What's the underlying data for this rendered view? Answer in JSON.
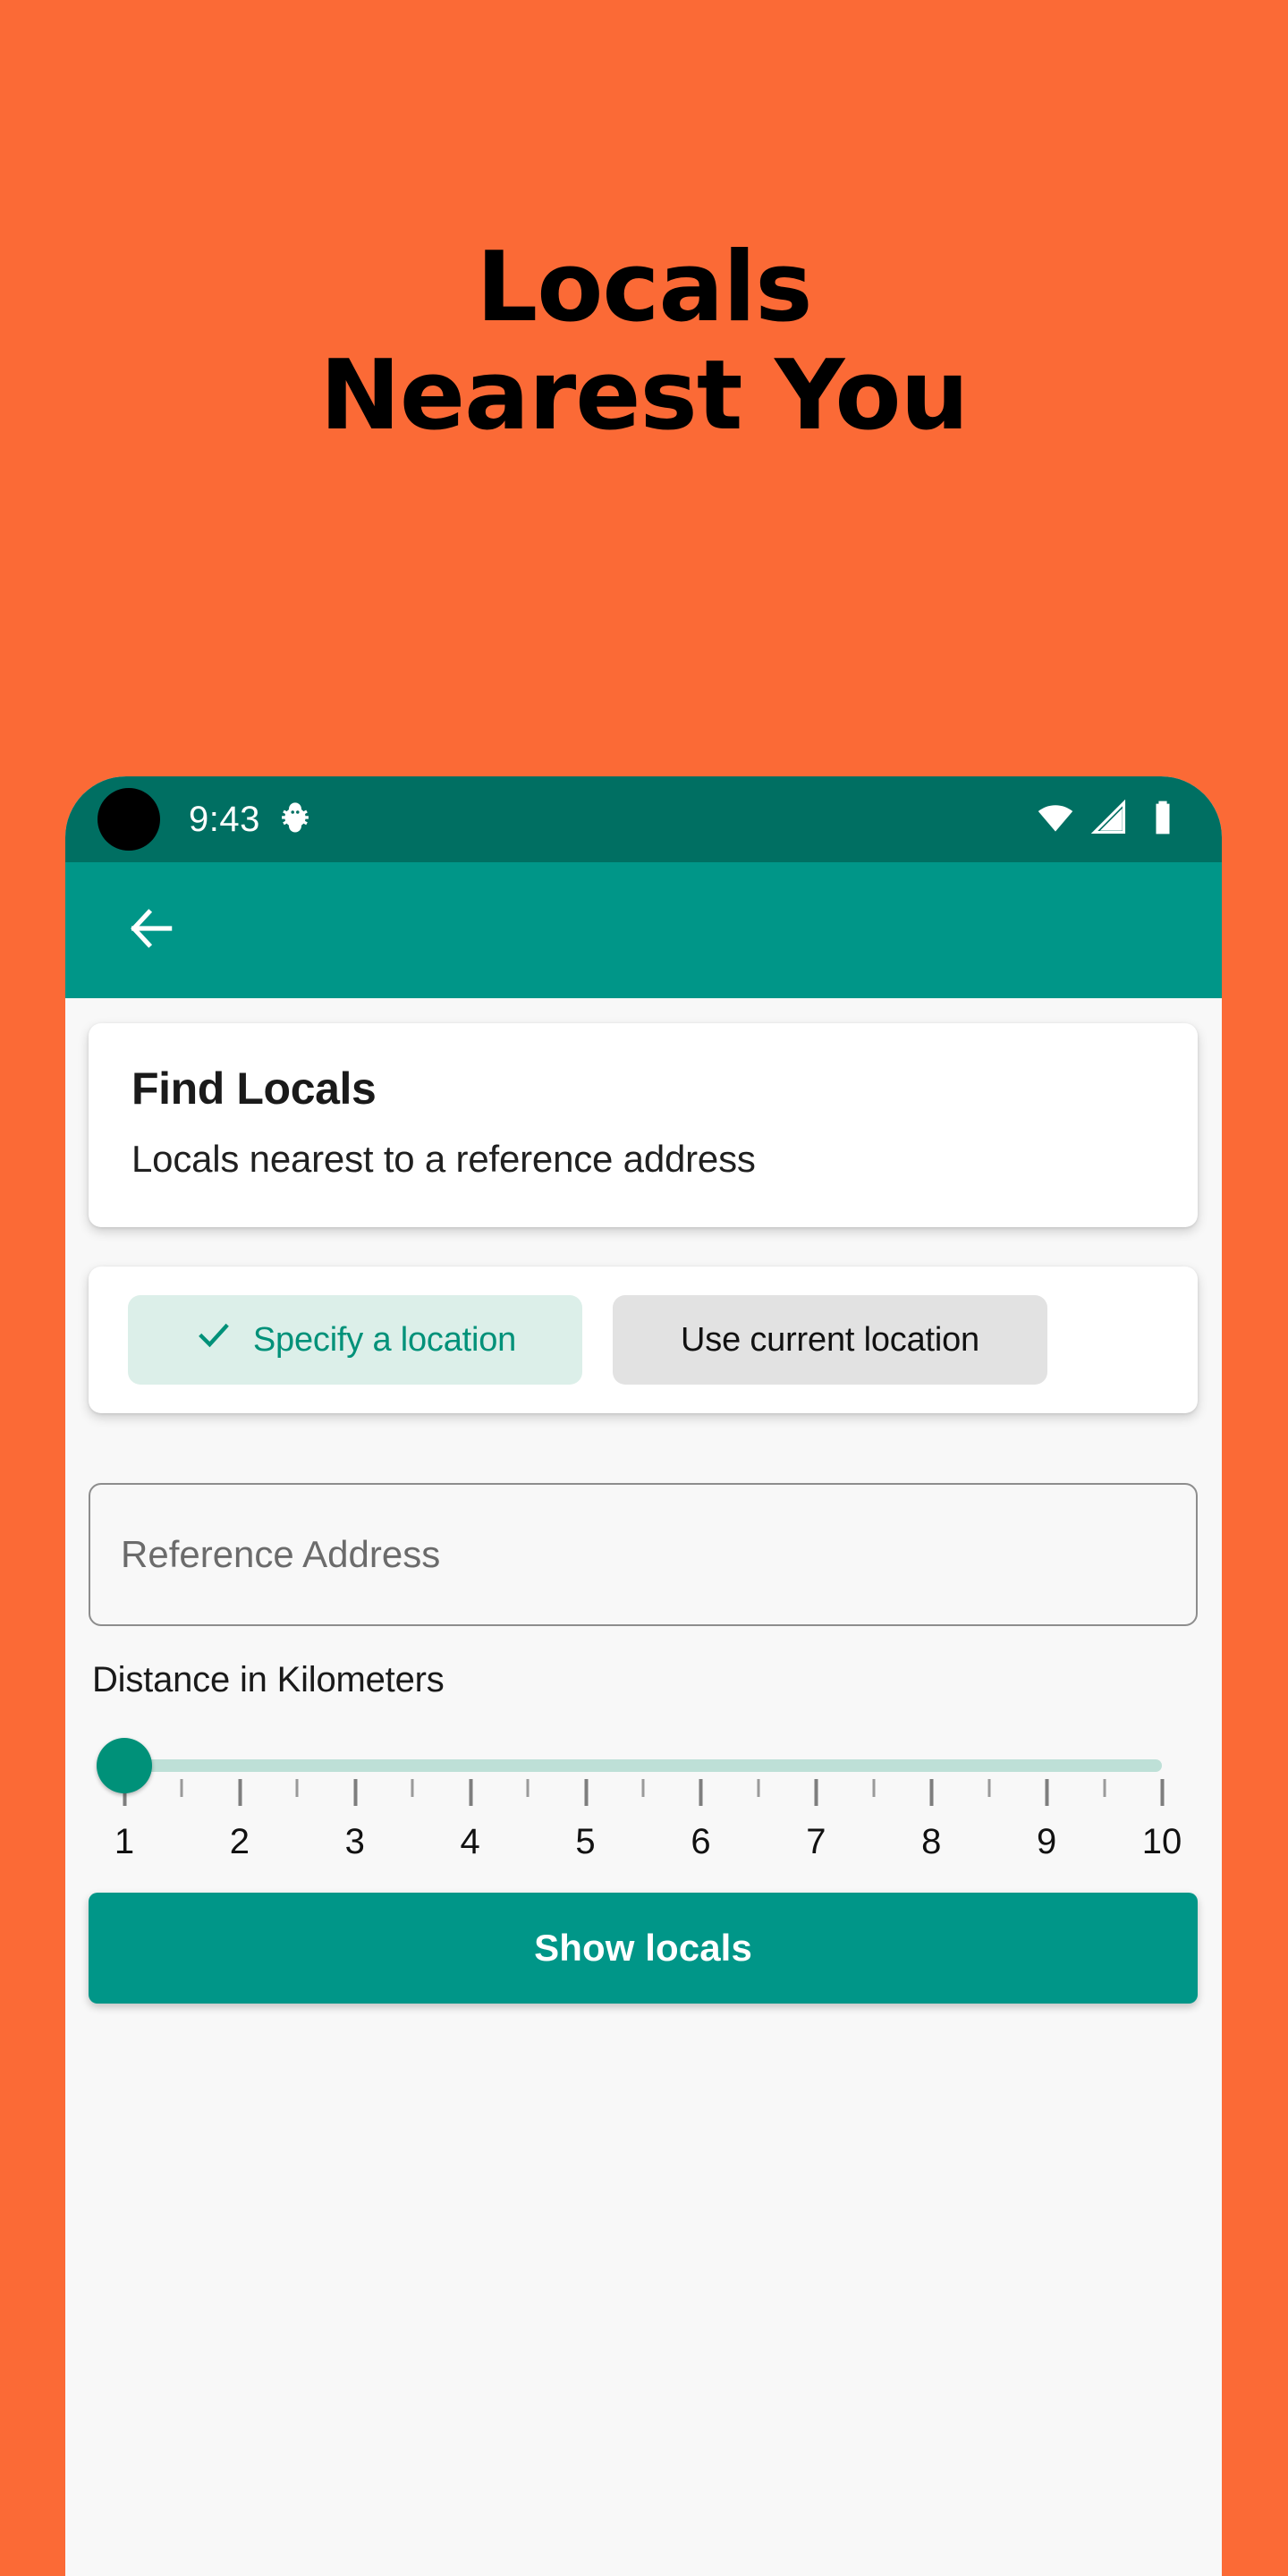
{
  "promo": {
    "headline": "Locals\nNearest You",
    "background_color": "#FB6A36",
    "text_color": "#000000"
  },
  "status_bar": {
    "time": "9:43",
    "background_color": "#006F62",
    "icons": [
      "bug-icon",
      "wifi-icon",
      "cellular-signal-icon",
      "battery-icon"
    ]
  },
  "app_bar": {
    "background_color": "#009688",
    "back_icon": "arrow-left-icon"
  },
  "info_card": {
    "title": "Find Locals",
    "subtitle": "Locals nearest to a reference address"
  },
  "location_mode": {
    "selected_index": 0,
    "options": [
      {
        "label": "Specify a location",
        "selected": true,
        "icon": "check-icon"
      },
      {
        "label": "Use current location",
        "selected": false,
        "icon": ""
      }
    ],
    "selected_bg": "#DCEFE9",
    "selected_fg": "#009179",
    "unselected_bg": "#E2E2E2",
    "unselected_fg": "#111111"
  },
  "address_field": {
    "placeholder": "Reference Address",
    "value": ""
  },
  "distance_slider": {
    "label": "Distance in Kilometers",
    "value": 1,
    "min": 1,
    "max": 10,
    "step": 1,
    "tick_labels": [
      "1",
      "2",
      "3",
      "4",
      "5",
      "6",
      "7",
      "8",
      "9",
      "10"
    ],
    "track_color": "#BEE0D7",
    "thumb_color": "#009179"
  },
  "submit_button": {
    "label": "Show locals",
    "background_color": "#009688",
    "text_color": "#FFFFFF"
  }
}
